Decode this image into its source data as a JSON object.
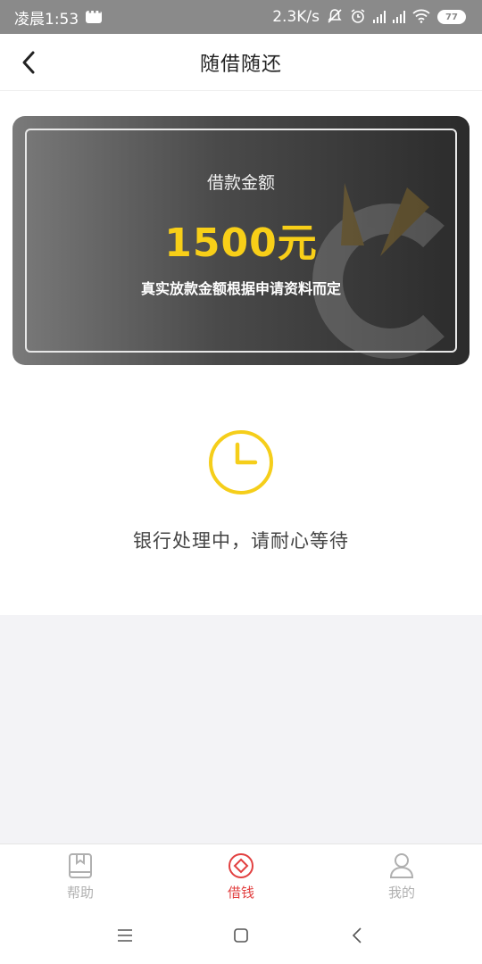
{
  "status_bar": {
    "time": "凌晨1:53",
    "net_speed": "2.3K/s",
    "battery": "77",
    "icons": [
      "message-icon",
      "mute-icon",
      "alarm-icon",
      "signal-icon",
      "signal-icon",
      "wifi-icon",
      "battery-icon"
    ]
  },
  "header": {
    "title": "随借随还",
    "back_icon": "chevron-left-icon"
  },
  "card": {
    "label": "借款金额",
    "amount": "1500元",
    "note": "真实放款金额根据申请资料而定"
  },
  "status": {
    "icon": "clock-icon",
    "text": "银行处理中，请耐心等待"
  },
  "tabs": [
    {
      "label": "帮助",
      "icon": "book-icon",
      "active": false
    },
    {
      "label": "借钱",
      "icon": "diamond-circle-icon",
      "active": true
    },
    {
      "label": "我的",
      "icon": "user-icon",
      "active": false
    }
  ],
  "colors": {
    "accent_yellow": "#f8cf18",
    "active_red": "#e24040",
    "inactive_grey": "#b0b0b0"
  }
}
